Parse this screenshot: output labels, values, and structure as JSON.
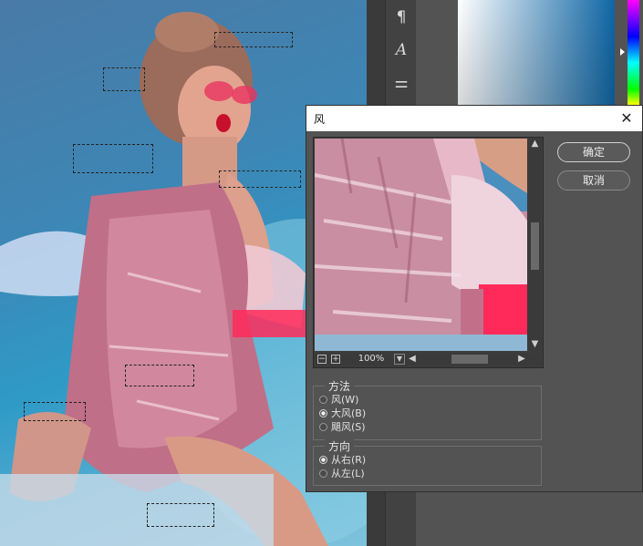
{
  "canvas": {
    "label": "photo-canvas"
  },
  "tools": {
    "paragraph_icon": "¶",
    "character_icon": "A",
    "adjust_icon": "⚌"
  },
  "dialog": {
    "title": "风",
    "close_glyph": "✕",
    "ok_label": "确定",
    "cancel_label": "取消",
    "zoom_value": "100%",
    "zoom_minus": "−",
    "zoom_plus": "+",
    "method": {
      "legend": "方法",
      "options": [
        {
          "label": "风(W)",
          "selected": false
        },
        {
          "label": "大风(B)",
          "selected": true
        },
        {
          "label": "飓风(S)",
          "selected": false
        }
      ]
    },
    "direction": {
      "legend": "方向",
      "options": [
        {
          "label": "从右(R)",
          "selected": true
        },
        {
          "label": "从左(L)",
          "selected": false
        }
      ]
    }
  },
  "colors": {
    "dialog_bg": "#535353",
    "accent_pink": "#e8355f",
    "canvas_blue": "#3d86b5"
  }
}
